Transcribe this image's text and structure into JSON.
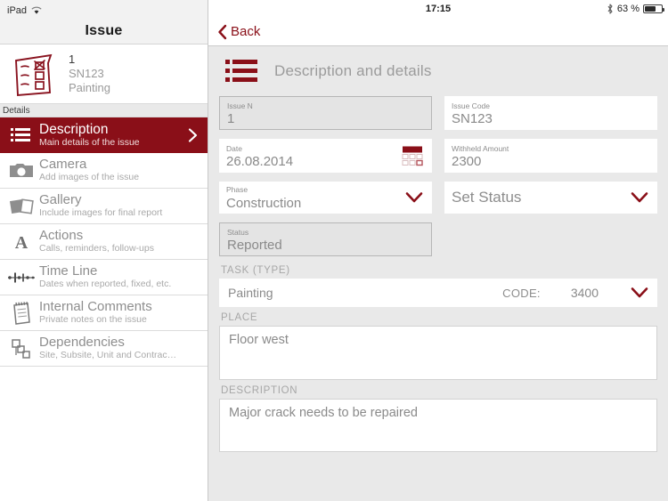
{
  "status_bar": {
    "device": "iPad",
    "wifi_icon": "wifi-icon",
    "time": "17:15",
    "bluetooth_icon": "bluetooth-icon",
    "battery_percent": "63 %",
    "battery_icon": "battery-icon"
  },
  "sidebar": {
    "title": "Issue",
    "issue_card": {
      "thumb_icon": "checklist-sketch-icon",
      "number": "1",
      "code": "SN123",
      "task": "Painting"
    },
    "section_label": "Details",
    "items": [
      {
        "icon": "list-lines-icon",
        "title": "Description",
        "subtitle": "Main details of the issue",
        "active": true,
        "chevron": "chevron-right-icon"
      },
      {
        "icon": "camera-icon",
        "title": "Camera",
        "subtitle": "Add images of the issue",
        "active": false
      },
      {
        "icon": "gallery-icon",
        "title": "Gallery",
        "subtitle": "Include images for final report",
        "active": false
      },
      {
        "icon": "letter-a-icon",
        "title": "Actions",
        "subtitle": "Calls, reminders, follow-ups",
        "active": false
      },
      {
        "icon": "timeline-icon",
        "title": "Time Line",
        "subtitle": "Dates when reported, fixed, etc.",
        "active": false
      },
      {
        "icon": "notepad-icon",
        "title": "Internal Comments",
        "subtitle": "Private notes on the issue",
        "active": false
      },
      {
        "icon": "dependencies-icon",
        "title": "Dependencies",
        "subtitle": "Site, Subsite, Unit and Contrac…",
        "active": false
      }
    ]
  },
  "detail": {
    "back_label": "Back",
    "back_icon": "chevron-left-icon",
    "page_icon": "list-lines-icon",
    "page_title": "Description and details",
    "fields": {
      "issue_n": {
        "label": "Issue N",
        "value": "1",
        "readonly": true
      },
      "issue_code": {
        "label": "Issue Code",
        "value": "SN123",
        "readonly": false
      },
      "date": {
        "label": "Date",
        "value": "26.08.2014",
        "icon": "calendar-icon"
      },
      "withheld_amount": {
        "label": "Withheld Amount",
        "value": "2300"
      },
      "phase": {
        "label": "Phase",
        "value": "Construction",
        "chevron": "chevron-down-icon"
      },
      "set_status": {
        "placeholder": "Set Status",
        "chevron": "chevron-down-icon"
      },
      "status": {
        "label": "Status",
        "value": "Reported",
        "readonly": true
      }
    },
    "task_section": {
      "label": "TASK (TYPE)",
      "name": "Painting",
      "code_label": "CODE:",
      "code_value": "3400",
      "chevron": "chevron-down-icon"
    },
    "place_section": {
      "label": "PLACE",
      "value": "Floor west"
    },
    "description_section": {
      "label": "DESCRIPTION",
      "value": "Major crack needs to be repaired"
    }
  },
  "colors": {
    "brand_dark_red": "#8a0f18",
    "panel_gray": "#e9e9e9",
    "text_gray": "#8a8a8a"
  }
}
